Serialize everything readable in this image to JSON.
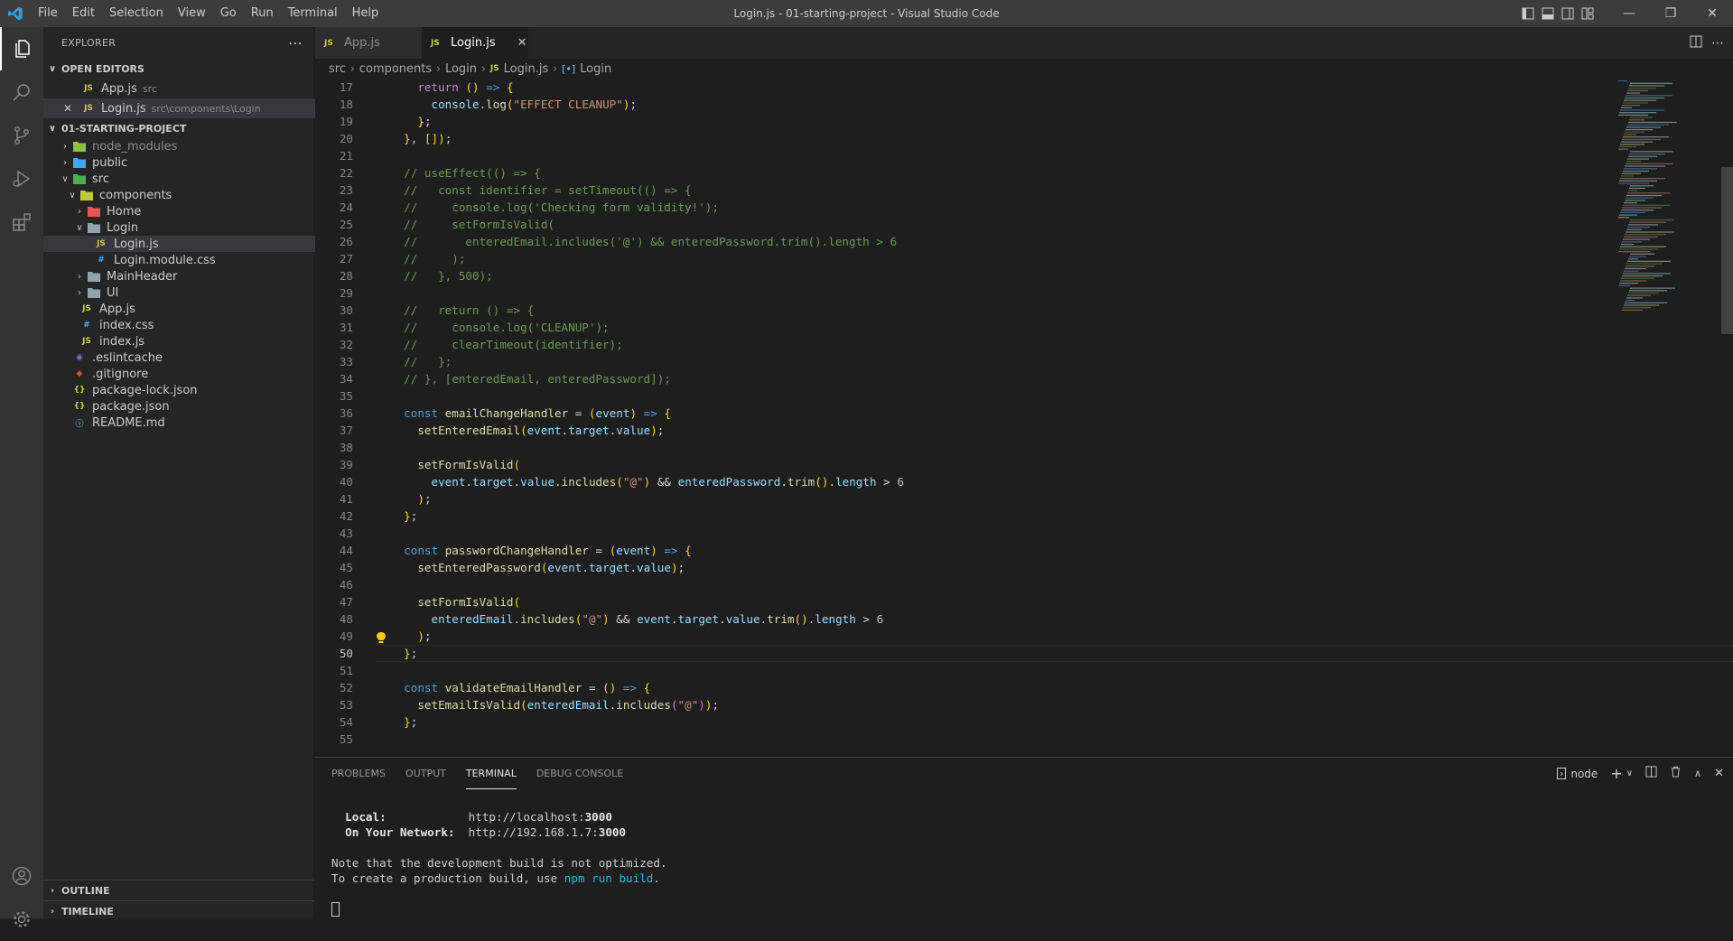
{
  "window": {
    "title": "Login.js - 01-starting-project - Visual Studio Code",
    "menu": [
      "File",
      "Edit",
      "Selection",
      "View",
      "Go",
      "Run",
      "Terminal",
      "Help"
    ]
  },
  "sidebar": {
    "header": "EXPLORER",
    "open_editors_label": "OPEN EDITORS",
    "open_editors": [
      {
        "name": "App.js",
        "desc": "src",
        "icon": "js-icon"
      },
      {
        "name": "Login.js",
        "desc": "src\\components\\Login",
        "icon": "js-icon"
      }
    ],
    "project_label": "01-STARTING-PROJECT",
    "tree": [
      {
        "name": "node_modules",
        "kind": "folder",
        "icon": "folder-node-icon"
      },
      {
        "name": "public",
        "kind": "folder",
        "icon": "folder-public-icon"
      },
      {
        "name": "src",
        "kind": "folder-open",
        "icon": "folder-src-icon"
      },
      {
        "name": "components",
        "kind": "folder-open",
        "icon": "folder-components-icon"
      },
      {
        "name": "Home",
        "kind": "folder",
        "icon": "folder-home-icon"
      },
      {
        "name": "Login",
        "kind": "folder-open",
        "icon": "folder-icon"
      },
      {
        "name": "Login.js",
        "kind": "file",
        "icon": "js-icon"
      },
      {
        "name": "Login.module.css",
        "kind": "file",
        "icon": "css-icon"
      },
      {
        "name": "MainHeader",
        "kind": "folder",
        "icon": "folder-icon"
      },
      {
        "name": "UI",
        "kind": "folder",
        "icon": "folder-icon"
      },
      {
        "name": "App.js",
        "kind": "file",
        "icon": "js-icon"
      },
      {
        "name": "index.css",
        "kind": "file",
        "icon": "css-icon"
      },
      {
        "name": "index.js",
        "kind": "file",
        "icon": "js-icon"
      },
      {
        "name": ".eslintcache",
        "kind": "file",
        "icon": "eslint-icon"
      },
      {
        "name": ".gitignore",
        "kind": "file",
        "icon": "git-icon"
      },
      {
        "name": "package-lock.json",
        "kind": "file",
        "icon": "json-icon"
      },
      {
        "name": "package.json",
        "kind": "file",
        "icon": "json-icon"
      },
      {
        "name": "README.md",
        "kind": "file",
        "icon": "info-icon"
      }
    ],
    "outline_label": "OUTLINE",
    "timeline_label": "TIMELINE"
  },
  "tabs": [
    {
      "label": "App.js",
      "active": false
    },
    {
      "label": "Login.js",
      "active": true
    }
  ],
  "breadcrumb": [
    "src",
    "components",
    "Login",
    "Login.js",
    "Login"
  ],
  "editor": {
    "current_line": 50,
    "lines": [
      {
        "n": 17,
        "t": "    return () => {"
      },
      {
        "n": 18,
        "t": "      console.log(\"EFFECT CLEANUP\");"
      },
      {
        "n": 19,
        "t": "    };"
      },
      {
        "n": 20,
        "t": "  }, []);"
      },
      {
        "n": 21,
        "t": ""
      },
      {
        "n": 22,
        "t": "  // useEffect(() => {"
      },
      {
        "n": 23,
        "t": "  //   const identifier = setTimeout(() => {"
      },
      {
        "n": 24,
        "t": "  //     console.log('Checking form validity!');"
      },
      {
        "n": 25,
        "t": "  //     setFormIsValid("
      },
      {
        "n": 26,
        "t": "  //       enteredEmail.includes('@') && enteredPassword.trim().length > 6"
      },
      {
        "n": 27,
        "t": "  //     );"
      },
      {
        "n": 28,
        "t": "  //   }, 500);"
      },
      {
        "n": 29,
        "t": ""
      },
      {
        "n": 30,
        "t": "  //   return () => {"
      },
      {
        "n": 31,
        "t": "  //     console.log('CLEANUP');"
      },
      {
        "n": 32,
        "t": "  //     clearTimeout(identifier);"
      },
      {
        "n": 33,
        "t": "  //   };"
      },
      {
        "n": 34,
        "t": "  // }, [enteredEmail, enteredPassword]);"
      },
      {
        "n": 35,
        "t": ""
      },
      {
        "n": 36,
        "t": "  const emailChangeHandler = (event) => {"
      },
      {
        "n": 37,
        "t": "    setEnteredEmail(event.target.value);"
      },
      {
        "n": 38,
        "t": ""
      },
      {
        "n": 39,
        "t": "    setFormIsValid("
      },
      {
        "n": 40,
        "t": "      event.target.value.includes(\"@\") && enteredPassword.trim().length > 6"
      },
      {
        "n": 41,
        "t": "    );"
      },
      {
        "n": 42,
        "t": "  };"
      },
      {
        "n": 43,
        "t": ""
      },
      {
        "n": 44,
        "t": "  const passwordChangeHandler = (event) => {"
      },
      {
        "n": 45,
        "t": "    setEnteredPassword(event.target.value);"
      },
      {
        "n": 46,
        "t": ""
      },
      {
        "n": 47,
        "t": "    setFormIsValid("
      },
      {
        "n": 48,
        "t": "      enteredEmail.includes(\"@\") && event.target.value.trim().length > 6"
      },
      {
        "n": 49,
        "t": "    );"
      },
      {
        "n": 50,
        "t": "  };"
      },
      {
        "n": 51,
        "t": ""
      },
      {
        "n": 52,
        "t": "  const validateEmailHandler = () => {"
      },
      {
        "n": 53,
        "t": "    setEmailIsValid(enteredEmail.includes(\"@\"));"
      },
      {
        "n": 54,
        "t": "  };"
      },
      {
        "n": 55,
        "t": ""
      }
    ]
  },
  "panel": {
    "tabs": [
      "PROBLEMS",
      "OUTPUT",
      "TERMINAL",
      "DEBUG CONSOLE"
    ],
    "active_tab": "TERMINAL",
    "terminal_name": "node",
    "terminal": {
      "local_label": "Local:",
      "local_url_prefix": "http://localhost:",
      "local_port": "3000",
      "network_label": "On Your Network:",
      "network_url_prefix": "http://192.168.1.7:",
      "network_port": "3000",
      "note_line": "Note that the development build is not optimized.",
      "prod_prefix": "To create a production build, use ",
      "prod_cmd": "npm run build",
      "prod_suffix": "."
    }
  },
  "colors": {
    "accent": "#007acc",
    "js": "#cbcb41",
    "css": "#42a5f5"
  }
}
